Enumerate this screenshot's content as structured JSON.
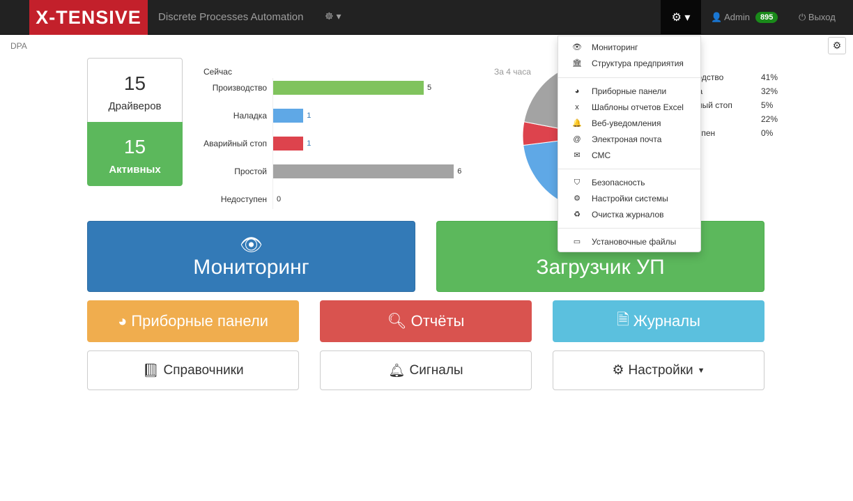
{
  "nav": {
    "logo": "X-TENSIVE",
    "brand": "Discrete Processes Automation",
    "plugins_icon": "☸ ▾",
    "settings_icon": "⚙ ▾",
    "user": "Admin",
    "badge": "895",
    "logout": "Выход"
  },
  "breadcrumb": "DPA",
  "stats": {
    "drivers_count": "15",
    "drivers_label": "Драйверов",
    "active_count": "15",
    "active_label": "Активных"
  },
  "chart_data": [
    {
      "type": "bar",
      "title": "Сейчас",
      "categories": [
        "Производство",
        "Наладка",
        "Аварийный стоп",
        "Простой",
        "Недоступен"
      ],
      "values": [
        5,
        1,
        1,
        6,
        0
      ],
      "colors": [
        "#80c35d",
        "#5fa8e6",
        "#dd434d",
        "#a3a3a3",
        "#cccccc"
      ]
    },
    {
      "type": "pie",
      "title": "За 4 часа",
      "categories": [
        "Производство",
        "Наладка",
        "Аварийный стоп",
        "Простой",
        "Недоступен"
      ],
      "values": [
        41,
        32,
        5,
        22,
        0
      ],
      "labels": [
        "41%",
        "32%",
        "5%",
        "22%",
        "0%"
      ],
      "colors": [
        "#80c35d",
        "#5fa8e6",
        "#dd434d",
        "#a3a3a3",
        "#cccccc"
      ]
    }
  ],
  "buttons": {
    "monitoring": "Мониторинг",
    "loader": "Загрузчик УП",
    "dashboards": "Приборные панели",
    "reports": "Отчёты",
    "journals": "Журналы",
    "references": "Справочники",
    "signals": "Сигналы",
    "settings": "Настройки"
  },
  "menu": {
    "items": [
      {
        "icon": "👁",
        "label": "Мониторинг"
      },
      {
        "icon": "🏛",
        "label": "Структура предприятия"
      },
      {
        "icon": "◕",
        "label": "Приборные панели"
      },
      {
        "icon": "x",
        "label": "Шаблоны отчетов Excel"
      },
      {
        "icon": "🔔",
        "label": "Веб-уведомления"
      },
      {
        "icon": "@",
        "label": "Электроная почта"
      },
      {
        "icon": "✉",
        "label": "СМС"
      },
      {
        "icon": "⛉",
        "label": "Безопасность"
      },
      {
        "icon": "⚙",
        "label": "Настройки системы"
      },
      {
        "icon": "♻",
        "label": "Очистка журналов"
      },
      {
        "icon": "▭",
        "label": "Установочные файлы"
      }
    ]
  }
}
